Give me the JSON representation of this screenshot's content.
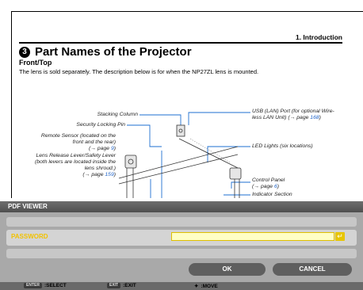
{
  "document": {
    "chapter": "1. Introduction",
    "section_number": "3",
    "heading": "Part Names of the Projector",
    "subheading": "Front/Top",
    "body": "The lens is sold separately. The description below is for when the NP27ZL lens is mounted.",
    "labels": {
      "stacking_column": "Stacking Column",
      "security_locking_pin": "Security Locking Pin",
      "remote_sensor_1": "Remote Sensor (located on the",
      "remote_sensor_2": "front and the rear)",
      "remote_sensor_3": "(→ page ",
      "remote_sensor_page": "9",
      "remote_sensor_4": ")",
      "lens_release_1": "Lens Release Lever/Safety Lever",
      "lens_release_2": "(both levers are located inside the",
      "lens_release_3": "lens shroud.)",
      "lens_release_4": "(→ page ",
      "lens_release_page": "159",
      "lens_release_5": ")",
      "usb_port_1": "USB (LAN) Port (for optional Wire-",
      "usb_port_2": "less LAN Unit) (→ page ",
      "usb_port_page": "168",
      "usb_port_3": ")",
      "led_lights": "LED Lights (six locations)",
      "control_panel_1": "Control Panel",
      "control_panel_2": "(→ page ",
      "control_panel_page": "6",
      "control_panel_3": ")",
      "indicator_section": "Indicator Section"
    }
  },
  "dialog": {
    "title": "PDF VIEWER",
    "password_label": "PASSWORD",
    "password_value": "",
    "enter_glyph": "↵",
    "ok_label": "OK",
    "cancel_label": "CANCEL",
    "guide": {
      "select_key": "ENTER",
      "select_label": ":SELECT",
      "exit_key": "EXIT",
      "exit_label": ":EXIT",
      "move_glyph": "✦",
      "move_label": ":MOVE"
    },
    "colors": {
      "accent": "#f2c200",
      "button": "#5f5f5f",
      "panel": "#a9a9a9",
      "title_bar": "#555555"
    }
  }
}
